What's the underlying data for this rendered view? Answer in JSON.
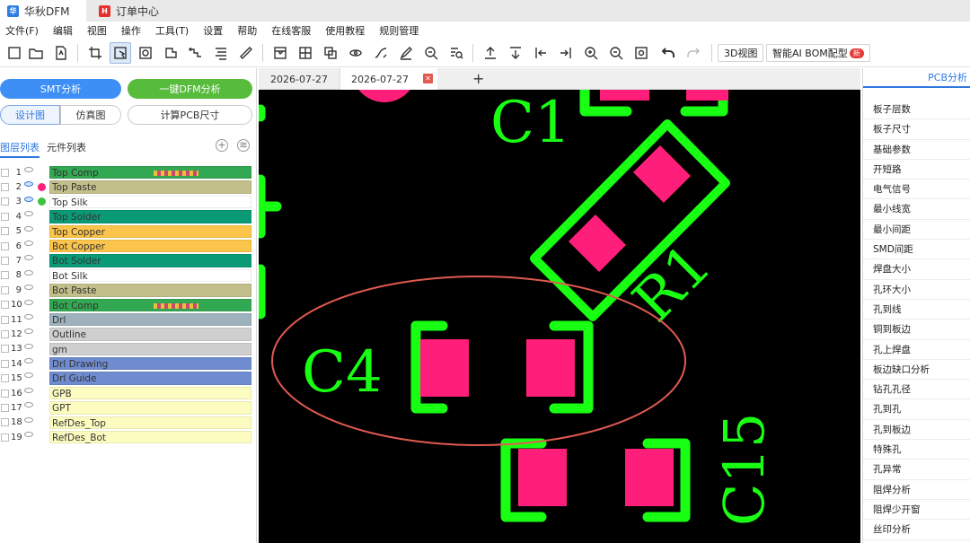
{
  "titlebar": {
    "tabs": [
      {
        "label": "华秋DFM",
        "icon": "huaqiu-logo-icon"
      },
      {
        "label": "订单中心",
        "icon": "order-logo-icon"
      }
    ]
  },
  "menu": [
    "文件(F)",
    "编辑",
    "视图",
    "操作",
    "工具(T)",
    "设置",
    "帮助",
    "在线客服",
    "使用教程",
    "规则管理"
  ],
  "toolbar": {
    "btn_3d": "3D视图",
    "btn_bom": "智能AI BOM配型",
    "bom_badge": "新"
  },
  "left": {
    "smt_btn": "SMT分析",
    "dfm_btn": "一键DFM分析",
    "seg_design": "设计图",
    "seg_sim": "仿真图",
    "calc_btn": "计算PCB尺寸",
    "tab_layers": "图层列表",
    "tab_components": "元件列表",
    "layers": [
      {
        "num": "1",
        "name": "Top Comp",
        "color": "#33a852"
      },
      {
        "num": "2",
        "name": "Top Paste",
        "color": "#c2bf8a"
      },
      {
        "num": "3",
        "name": "Top Silk",
        "color": "#ffffff"
      },
      {
        "num": "4",
        "name": "Top Solder",
        "color": "#0a9b76"
      },
      {
        "num": "5",
        "name": "Top Copper",
        "color": "#fbc44a"
      },
      {
        "num": "6",
        "name": "Bot Copper",
        "color": "#fbc44a"
      },
      {
        "num": "7",
        "name": "Bot Solder",
        "color": "#0a9b76"
      },
      {
        "num": "8",
        "name": "Bot Silk",
        "color": "#ffffff"
      },
      {
        "num": "9",
        "name": "Bot Paste",
        "color": "#c2bf8a"
      },
      {
        "num": "10",
        "name": "Bot Comp",
        "color": "#33a852"
      },
      {
        "num": "11",
        "name": "Drl",
        "color": "#9db2bd"
      },
      {
        "num": "12",
        "name": "Outline",
        "color": "#cfcfcf"
      },
      {
        "num": "13",
        "name": "gm",
        "color": "#cfcfcf"
      },
      {
        "num": "14",
        "name": "Drl Drawing",
        "color": "#6f8cd0"
      },
      {
        "num": "15",
        "name": "Drl Guide",
        "color": "#6f8cd0"
      },
      {
        "num": "16",
        "name": "GPB",
        "color": "#fdfcc0"
      },
      {
        "num": "17",
        "name": "GPT",
        "color": "#fdfcc0"
      },
      {
        "num": "18",
        "name": "RefDes_Top",
        "color": "#fdfcc0"
      },
      {
        "num": "19",
        "name": "RefDes_Bot",
        "color": "#fdfcc0"
      }
    ]
  },
  "doc_tabs": [
    "2026-07-27",
    "2026-07-27"
  ],
  "board": {
    "labels": {
      "c1": "C1",
      "r1": "R1",
      "c4": "C4",
      "c15": "C15"
    },
    "colors": {
      "silk": "#19ff14",
      "pad": "#ff1f7a",
      "highlight": "#e05a50",
      "background": "#000000"
    }
  },
  "right": {
    "title": "PCB分析",
    "items": [
      "板子层数",
      "板子尺寸",
      "基础参数",
      "开短路",
      "电气信号",
      "最小线宽",
      "最小间距",
      "SMD间距",
      "焊盘大小",
      "孔环大小",
      "孔到线",
      "铜到板边",
      "孔上焊盘",
      "板边缺口分析",
      "钻孔孔径",
      "孔到孔",
      "孔到板边",
      "特殊孔",
      "孔异常",
      "阻焊分析",
      "阻焊少开窗",
      "丝印分析"
    ]
  }
}
